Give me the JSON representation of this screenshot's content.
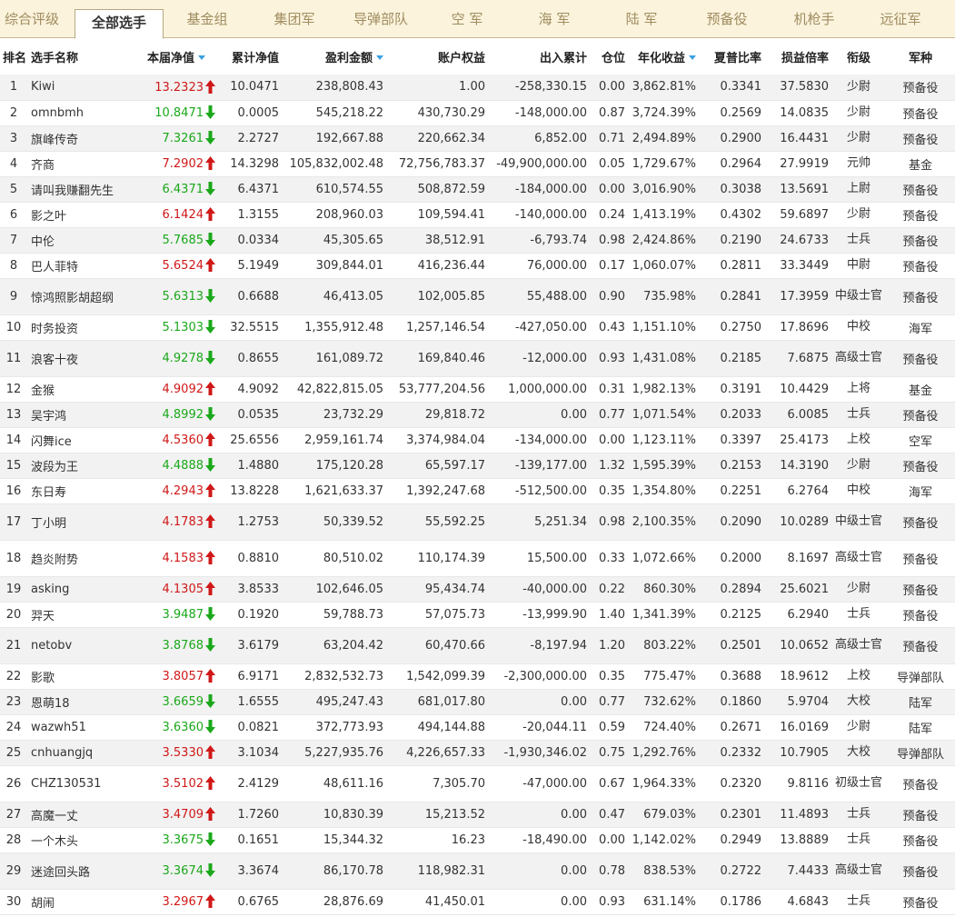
{
  "tabs": [
    {
      "label": "综合评级",
      "active": false
    },
    {
      "label": "全部选手",
      "active": true
    },
    {
      "label": "基金组",
      "active": false
    },
    {
      "label": "集团军",
      "active": false
    },
    {
      "label": "导弹部队",
      "active": false
    },
    {
      "label": "空  军",
      "active": false
    },
    {
      "label": "海  军",
      "active": false
    },
    {
      "label": "陆  军",
      "active": false
    },
    {
      "label": "预备役",
      "active": false
    },
    {
      "label": "机枪手",
      "active": false
    },
    {
      "label": "远征军",
      "active": false
    }
  ],
  "columns": [
    {
      "label": "排名",
      "sorted": false
    },
    {
      "label": "选手名称",
      "sorted": false
    },
    {
      "label": "本届净值",
      "sorted": true
    },
    {
      "label": "累计净值",
      "sorted": false
    },
    {
      "label": "盈利金额",
      "sorted": true
    },
    {
      "label": "账户权益",
      "sorted": false
    },
    {
      "label": "出入累计",
      "sorted": false
    },
    {
      "label": "仓位",
      "sorted": false
    },
    {
      "label": "年化收益",
      "sorted": true
    },
    {
      "label": "夏普比率",
      "sorted": false
    },
    {
      "label": "损益倍率",
      "sorted": false
    },
    {
      "label": "衔级",
      "sorted": false
    },
    {
      "label": "军种",
      "sorted": false
    }
  ],
  "trend_icons": {
    "up": "red-up-arrow-icon",
    "down": "green-down-arrow-icon"
  },
  "colors": {
    "up": "#d01818",
    "down": "#1aa81a",
    "sort_icon": "#3aa0e0"
  },
  "rows": [
    {
      "rank": "1",
      "name": "Kiwi",
      "nav": "13.2323",
      "trend": "up",
      "cum": "10.0471",
      "profit": "238,808.43",
      "equity": "1.00",
      "flow": "-258,330.15",
      "pos": "0.00",
      "annual": "3,862.81%",
      "sharpe": "0.3341",
      "plr": "37.5830",
      "rank_title": "少尉",
      "branch": "预备役"
    },
    {
      "rank": "2",
      "name": "omnbmh",
      "nav": "10.8471",
      "trend": "down",
      "cum": "0.0005",
      "profit": "545,218.22",
      "equity": "430,730.29",
      "flow": "-148,000.00",
      "pos": "0.87",
      "annual": "3,724.39%",
      "sharpe": "0.2569",
      "plr": "14.0835",
      "rank_title": "少尉",
      "branch": "预备役"
    },
    {
      "rank": "3",
      "name": "旗峰传奇",
      "nav": "7.3261",
      "trend": "down",
      "cum": "2.2727",
      "profit": "192,667.88",
      "equity": "220,662.34",
      "flow": "6,852.00",
      "pos": "0.71",
      "annual": "2,494.89%",
      "sharpe": "0.2900",
      "plr": "16.4431",
      "rank_title": "少尉",
      "branch": "预备役"
    },
    {
      "rank": "4",
      "name": "齐商",
      "nav": "7.2902",
      "trend": "up",
      "cum": "14.3298",
      "profit": "105,832,002.48",
      "equity": "72,756,783.37",
      "flow": "-49,900,000.00",
      "pos": "0.05",
      "annual": "1,729.67%",
      "sharpe": "0.2964",
      "plr": "27.9919",
      "rank_title": "元帅",
      "branch": "基金"
    },
    {
      "rank": "5",
      "name": "请叫我赚翻先生",
      "nav": "6.4371",
      "trend": "down",
      "cum": "6.4371",
      "profit": "610,574.55",
      "equity": "508,872.59",
      "flow": "-184,000.00",
      "pos": "0.00",
      "annual": "3,016.90%",
      "sharpe": "0.3038",
      "plr": "13.5691",
      "rank_title": "上尉",
      "branch": "预备役"
    },
    {
      "rank": "6",
      "name": "影之叶",
      "nav": "6.1424",
      "trend": "up",
      "cum": "1.3155",
      "profit": "208,960.03",
      "equity": "109,594.41",
      "flow": "-140,000.00",
      "pos": "0.24",
      "annual": "1,413.19%",
      "sharpe": "0.4302",
      "plr": "59.6897",
      "rank_title": "少尉",
      "branch": "预备役"
    },
    {
      "rank": "7",
      "name": "中伦",
      "nav": "5.7685",
      "trend": "down",
      "cum": "0.0334",
      "profit": "45,305.65",
      "equity": "38,512.91",
      "flow": "-6,793.74",
      "pos": "0.98",
      "annual": "2,424.86%",
      "sharpe": "0.2190",
      "plr": "24.6733",
      "rank_title": "士兵",
      "branch": "预备役"
    },
    {
      "rank": "8",
      "name": "巴人菲特",
      "nav": "5.6524",
      "trend": "up",
      "cum": "5.1949",
      "profit": "309,844.01",
      "equity": "416,236.44",
      "flow": "76,000.00",
      "pos": "0.17",
      "annual": "1,060.07%",
      "sharpe": "0.2811",
      "plr": "33.3449",
      "rank_title": "中尉",
      "branch": "预备役"
    },
    {
      "rank": "9",
      "name": "惊鸿照影胡超纲",
      "nav": "5.6313",
      "trend": "down",
      "cum": "0.6688",
      "profit": "46,413.05",
      "equity": "102,005.85",
      "flow": "55,488.00",
      "pos": "0.90",
      "annual": "735.98%",
      "sharpe": "0.2841",
      "plr": "17.3959",
      "rank_title": "中级士官",
      "branch": "预备役",
      "tall": true
    },
    {
      "rank": "10",
      "name": "时务投资",
      "nav": "5.1303",
      "trend": "down",
      "cum": "32.5515",
      "profit": "1,355,912.48",
      "equity": "1,257,146.54",
      "flow": "-427,050.00",
      "pos": "0.43",
      "annual": "1,151.10%",
      "sharpe": "0.2750",
      "plr": "17.8696",
      "rank_title": "中校",
      "branch": "海军"
    },
    {
      "rank": "11",
      "name": "浪客十夜",
      "nav": "4.9278",
      "trend": "down",
      "cum": "0.8655",
      "profit": "161,089.72",
      "equity": "169,840.46",
      "flow": "-12,000.00",
      "pos": "0.93",
      "annual": "1,431.08%",
      "sharpe": "0.2185",
      "plr": "7.6875",
      "rank_title": "高级士官",
      "branch": "预备役",
      "tall": true
    },
    {
      "rank": "12",
      "name": "金猴",
      "nav": "4.9092",
      "trend": "up",
      "cum": "4.9092",
      "profit": "42,822,815.05",
      "equity": "53,777,204.56",
      "flow": "1,000,000.00",
      "pos": "0.31",
      "annual": "1,982.13%",
      "sharpe": "0.3191",
      "plr": "10.4429",
      "rank_title": "上将",
      "branch": "基金"
    },
    {
      "rank": "13",
      "name": "吴宇鸿",
      "nav": "4.8992",
      "trend": "down",
      "cum": "0.0535",
      "profit": "23,732.29",
      "equity": "29,818.72",
      "flow": "0.00",
      "pos": "0.77",
      "annual": "1,071.54%",
      "sharpe": "0.2033",
      "plr": "6.0085",
      "rank_title": "士兵",
      "branch": "预备役"
    },
    {
      "rank": "14",
      "name": "闪舞ice",
      "nav": "4.5360",
      "trend": "up",
      "cum": "25.6556",
      "profit": "2,959,161.74",
      "equity": "3,374,984.04",
      "flow": "-134,000.00",
      "pos": "0.00",
      "annual": "1,123.11%",
      "sharpe": "0.3397",
      "plr": "25.4173",
      "rank_title": "上校",
      "branch": "空军"
    },
    {
      "rank": "15",
      "name": "波段为王",
      "nav": "4.4888",
      "trend": "down",
      "cum": "1.4880",
      "profit": "175,120.28",
      "equity": "65,597.17",
      "flow": "-139,177.00",
      "pos": "1.32",
      "annual": "1,595.39%",
      "sharpe": "0.2153",
      "plr": "14.3190",
      "rank_title": "少尉",
      "branch": "预备役"
    },
    {
      "rank": "16",
      "name": "东日寿",
      "nav": "4.2943",
      "trend": "up",
      "cum": "13.8228",
      "profit": "1,621,633.37",
      "equity": "1,392,247.68",
      "flow": "-512,500.00",
      "pos": "0.35",
      "annual": "1,354.80%",
      "sharpe": "0.2251",
      "plr": "6.2764",
      "rank_title": "中校",
      "branch": "海军"
    },
    {
      "rank": "17",
      "name": "丁小明",
      "nav": "4.1783",
      "trend": "up",
      "cum": "1.2753",
      "profit": "50,339.52",
      "equity": "55,592.25",
      "flow": "5,251.34",
      "pos": "0.98",
      "annual": "2,100.35%",
      "sharpe": "0.2090",
      "plr": "10.0289",
      "rank_title": "中级士官",
      "branch": "预备役",
      "tall": true
    },
    {
      "rank": "18",
      "name": "趋炎附势",
      "nav": "4.1583",
      "trend": "up",
      "cum": "0.8810",
      "profit": "80,510.02",
      "equity": "110,174.39",
      "flow": "15,500.00",
      "pos": "0.33",
      "annual": "1,072.66%",
      "sharpe": "0.2000",
      "plr": "8.1697",
      "rank_title": "高级士官",
      "branch": "预备役",
      "tall": true
    },
    {
      "rank": "19",
      "name": "asking",
      "nav": "4.1305",
      "trend": "up",
      "cum": "3.8533",
      "profit": "102,646.05",
      "equity": "95,434.74",
      "flow": "-40,000.00",
      "pos": "0.22",
      "annual": "860.30%",
      "sharpe": "0.2894",
      "plr": "25.6021",
      "rank_title": "少尉",
      "branch": "预备役"
    },
    {
      "rank": "20",
      "name": "羿天",
      "nav": "3.9487",
      "trend": "down",
      "cum": "0.1920",
      "profit": "59,788.73",
      "equity": "57,075.73",
      "flow": "-13,999.90",
      "pos": "1.40",
      "annual": "1,341.39%",
      "sharpe": "0.2125",
      "plr": "6.2940",
      "rank_title": "士兵",
      "branch": "预备役"
    },
    {
      "rank": "21",
      "name": "netobv",
      "nav": "3.8768",
      "trend": "down",
      "cum": "3.6179",
      "profit": "63,204.42",
      "equity": "60,470.66",
      "flow": "-8,197.94",
      "pos": "1.20",
      "annual": "803.22%",
      "sharpe": "0.2501",
      "plr": "10.0652",
      "rank_title": "高级士官",
      "branch": "预备役",
      "tall": true
    },
    {
      "rank": "22",
      "name": "影歌",
      "nav": "3.8057",
      "trend": "up",
      "cum": "6.9171",
      "profit": "2,832,532.73",
      "equity": "1,542,099.39",
      "flow": "-2,300,000.00",
      "pos": "0.35",
      "annual": "775.47%",
      "sharpe": "0.3688",
      "plr": "18.9612",
      "rank_title": "上校",
      "branch": "导弹部队"
    },
    {
      "rank": "23",
      "name": "恩萌18",
      "nav": "3.6659",
      "trend": "down",
      "cum": "1.6555",
      "profit": "495,247.43",
      "equity": "681,017.80",
      "flow": "0.00",
      "pos": "0.77",
      "annual": "732.62%",
      "sharpe": "0.1860",
      "plr": "5.9704",
      "rank_title": "大校",
      "branch": "陆军"
    },
    {
      "rank": "24",
      "name": "wazwh51",
      "nav": "3.6360",
      "trend": "down",
      "cum": "0.0821",
      "profit": "372,773.93",
      "equity": "494,144.88",
      "flow": "-20,044.11",
      "pos": "0.59",
      "annual": "724.40%",
      "sharpe": "0.2671",
      "plr": "16.0169",
      "rank_title": "少尉",
      "branch": "陆军"
    },
    {
      "rank": "25",
      "name": "cnhuangjq",
      "nav": "3.5330",
      "trend": "up",
      "cum": "3.1034",
      "profit": "5,227,935.76",
      "equity": "4,226,657.33",
      "flow": "-1,930,346.02",
      "pos": "0.75",
      "annual": "1,292.76%",
      "sharpe": "0.2332",
      "plr": "10.7905",
      "rank_title": "大校",
      "branch": "导弹部队"
    },
    {
      "rank": "26",
      "name": "CHZ130531",
      "nav": "3.5102",
      "trend": "up",
      "cum": "2.4129",
      "profit": "48,611.16",
      "equity": "7,305.70",
      "flow": "-47,000.00",
      "pos": "0.67",
      "annual": "1,964.33%",
      "sharpe": "0.2320",
      "plr": "9.8116",
      "rank_title": "初级士官",
      "branch": "预备役",
      "tall": true
    },
    {
      "rank": "27",
      "name": "高魔一丈",
      "nav": "3.4709",
      "trend": "up",
      "cum": "1.7260",
      "profit": "10,830.39",
      "equity": "15,213.52",
      "flow": "0.00",
      "pos": "0.47",
      "annual": "679.03%",
      "sharpe": "0.2301",
      "plr": "11.4893",
      "rank_title": "士兵",
      "branch": "预备役"
    },
    {
      "rank": "28",
      "name": "一个木头",
      "nav": "3.3675",
      "trend": "down",
      "cum": "0.1651",
      "profit": "15,344.32",
      "equity": "16.23",
      "flow": "-18,490.00",
      "pos": "0.00",
      "annual": "1,142.02%",
      "sharpe": "0.2949",
      "plr": "13.8889",
      "rank_title": "士兵",
      "branch": "预备役"
    },
    {
      "rank": "29",
      "name": "迷途回头路",
      "nav": "3.3674",
      "trend": "down",
      "cum": "3.3674",
      "profit": "86,170.78",
      "equity": "118,982.31",
      "flow": "0.00",
      "pos": "0.78",
      "annual": "838.53%",
      "sharpe": "0.2722",
      "plr": "7.4433",
      "rank_title": "高级士官",
      "branch": "预备役",
      "tall": true
    },
    {
      "rank": "30",
      "name": "胡闹",
      "nav": "3.2967",
      "trend": "up",
      "cum": "0.6765",
      "profit": "28,876.69",
      "equity": "41,450.01",
      "flow": "0.00",
      "pos": "0.93",
      "annual": "631.14%",
      "sharpe": "0.1786",
      "plr": "4.6843",
      "rank_title": "士兵",
      "branch": "预备役"
    }
  ]
}
